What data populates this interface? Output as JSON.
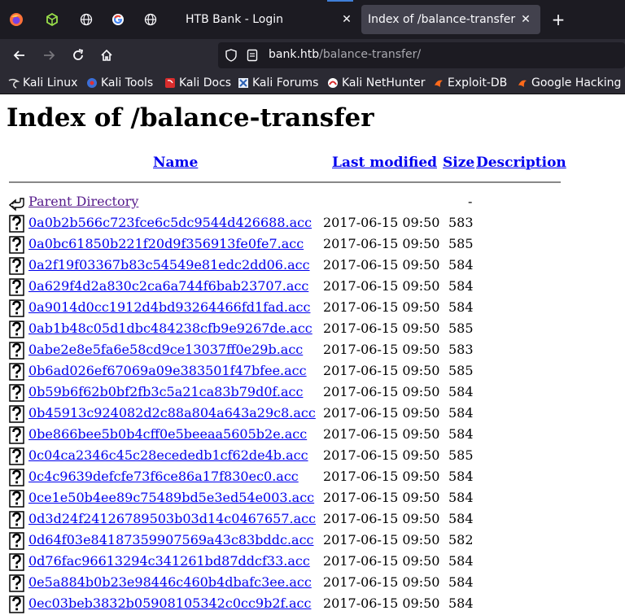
{
  "browser": {
    "tabs": [
      {
        "title": "HTB Bank - Login",
        "active": false
      },
      {
        "title": "Index of /balance-transfer",
        "active": true
      }
    ],
    "url_host": "bank.htb",
    "url_path": "/balance-transfer/",
    "bookmarks": [
      {
        "label": "Kali Linux",
        "icon": "kali-dragon-icon"
      },
      {
        "label": "Kali Tools",
        "icon": "kali-tools-icon"
      },
      {
        "label": "Kali Docs",
        "icon": "kali-docs-icon"
      },
      {
        "label": "Kali Forums",
        "icon": "kali-forums-icon"
      },
      {
        "label": "Kali NetHunter",
        "icon": "nethunter-icon"
      },
      {
        "label": "Exploit-DB",
        "icon": "exploit-db-icon"
      },
      {
        "label": "Google Hacking D",
        "icon": "ghdb-icon"
      }
    ],
    "colors": {
      "tabbar": "#1c1b22",
      "navbar": "#2b2a33",
      "active_tab": "#42414d",
      "link": "#0000ee",
      "visited": "#551a8b"
    }
  },
  "page": {
    "title": "Index of /balance-transfer",
    "columns": {
      "name": "Name",
      "last_modified": "Last modified",
      "size": "Size",
      "description": "Description"
    },
    "parent": {
      "label": "Parent Directory",
      "size": "-"
    },
    "files": [
      {
        "name": "0a0b2b566c723fce6c5dc9544d426688.acc",
        "date": "2017-06-15 09:50",
        "size": "583"
      },
      {
        "name": "0a0bc61850b221f20d9f356913fe0fe7.acc",
        "date": "2017-06-15 09:50",
        "size": "585"
      },
      {
        "name": "0a2f19f03367b83c54549e81edc2dd06.acc",
        "date": "2017-06-15 09:50",
        "size": "584"
      },
      {
        "name": "0a629f4d2a830c2ca6a744f6bab23707.acc",
        "date": "2017-06-15 09:50",
        "size": "584"
      },
      {
        "name": "0a9014d0cc1912d4bd93264466fd1fad.acc",
        "date": "2017-06-15 09:50",
        "size": "584"
      },
      {
        "name": "0ab1b48c05d1dbc484238cfb9e9267de.acc",
        "date": "2017-06-15 09:50",
        "size": "585"
      },
      {
        "name": "0abe2e8e5fa6e58cd9ce13037ff0e29b.acc",
        "date": "2017-06-15 09:50",
        "size": "583"
      },
      {
        "name": "0b6ad026ef67069a09e383501f47bfee.acc",
        "date": "2017-06-15 09:50",
        "size": "585"
      },
      {
        "name": "0b59b6f62b0bf2fb3c5a21ca83b79d0f.acc",
        "date": "2017-06-15 09:50",
        "size": "584"
      },
      {
        "name": "0b45913c924082d2c88a804a643a29c8.acc",
        "date": "2017-06-15 09:50",
        "size": "584"
      },
      {
        "name": "0be866bee5b0b4cff0e5beeaa5605b2e.acc",
        "date": "2017-06-15 09:50",
        "size": "584"
      },
      {
        "name": "0c04ca2346c45c28ecededb1cf62de4b.acc",
        "date": "2017-06-15 09:50",
        "size": "585"
      },
      {
        "name": "0c4c9639defcfe73f6ce86a17f830ec0.acc",
        "date": "2017-06-15 09:50",
        "size": "584"
      },
      {
        "name": "0ce1e50b4ee89c75489bd5e3ed54e003.acc",
        "date": "2017-06-15 09:50",
        "size": "584"
      },
      {
        "name": "0d3d24f24126789503b03d14c0467657.acc",
        "date": "2017-06-15 09:50",
        "size": "584"
      },
      {
        "name": "0d64f03e84187359907569a43c83bddc.acc",
        "date": "2017-06-15 09:50",
        "size": "582"
      },
      {
        "name": "0d76fac96613294c341261bd87ddcf33.acc",
        "date": "2017-06-15 09:50",
        "size": "584"
      },
      {
        "name": "0e5a884b0b23e98446c460b4dbafc3ee.acc",
        "date": "2017-06-15 09:50",
        "size": "584"
      },
      {
        "name": "0ec03beb3832b05908105342c0cc9b2f.acc",
        "date": "2017-06-15 09:50",
        "size": "584"
      }
    ]
  }
}
